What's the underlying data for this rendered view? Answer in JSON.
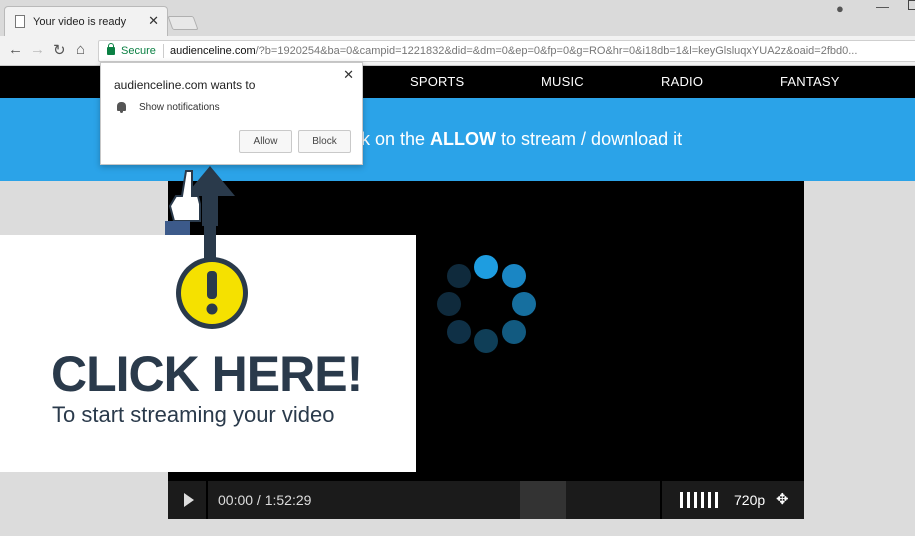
{
  "browser": {
    "tab_title": "Your video is ready",
    "tab_close": "✕",
    "url_host": "audienceline.com",
    "url_rest": "/?b=1920254&ba=0&campid=1221832&did=&dm=0&ep=0&fp=0&g=RO&hr=0&i18db=1&l=keyGlsluqxYUA2z&oaid=2fbd0...",
    "secure_label": "Secure",
    "nav": {
      "back": "←",
      "forward": "→",
      "reload": "↻",
      "home": "⌂"
    },
    "profile": "●",
    "minimize": "—"
  },
  "page": {
    "nav_items": [
      "SPORTS",
      "MUSIC",
      "RADIO",
      "FANTASY"
    ],
    "banner_prefix": "ck on the ",
    "banner_bold": "ALLOW",
    "banner_suffix": " to stream / download it",
    "click_title": "CLICK HERE!",
    "click_subtitle": "To start streaming your video",
    "player": {
      "time": "00:00 / 1:52:29",
      "quality": "720p",
      "fullscreen": "✥"
    }
  },
  "popup": {
    "title": "audienceline.com wants to",
    "permission": "Show notifications",
    "allow": "Allow",
    "block": "Block",
    "close": "✕"
  },
  "colors": {
    "banner": "#2ba3e8",
    "spinner_active": "#1e9de0",
    "secure": "#0b8043",
    "warning_yellow": "#f5e100",
    "click_text": "#2a3a4b"
  }
}
